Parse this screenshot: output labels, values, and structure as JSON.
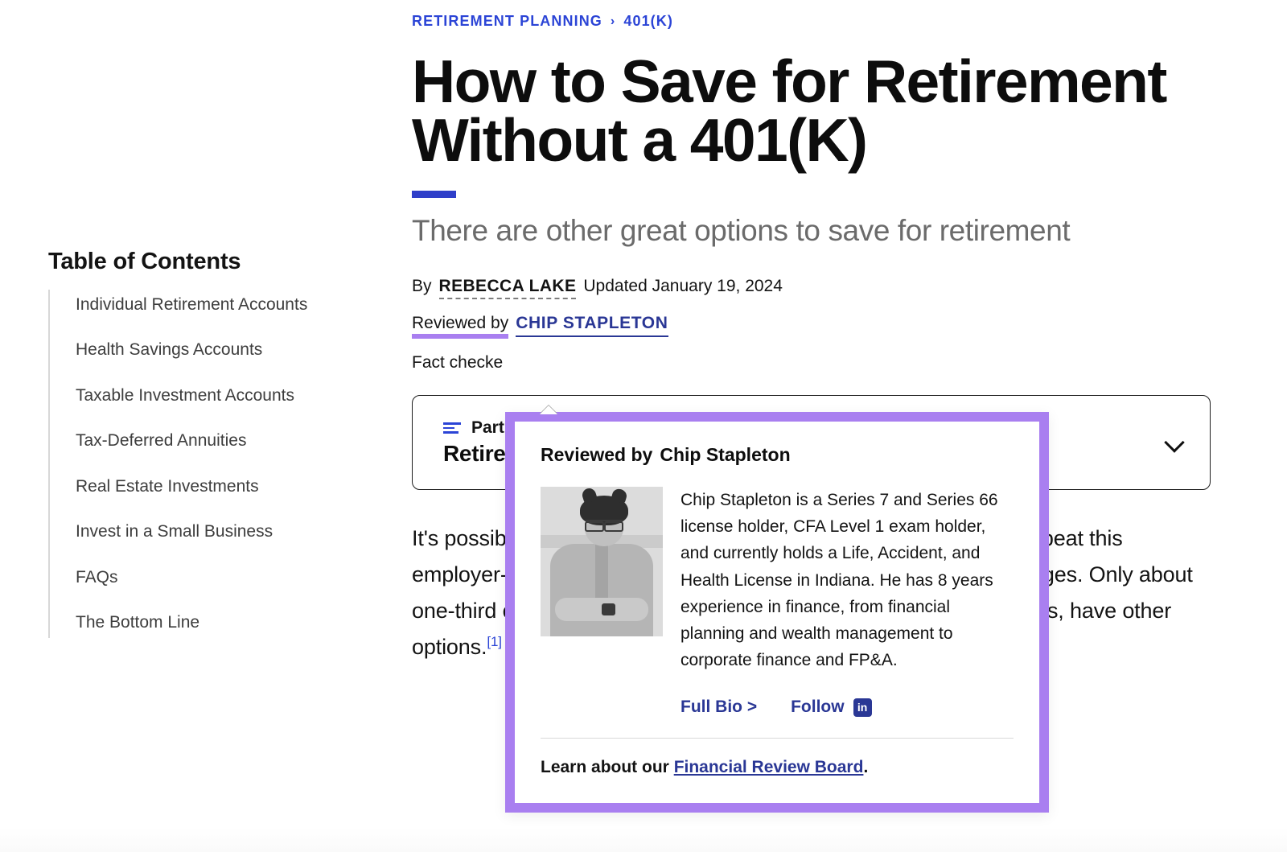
{
  "breadcrumb": {
    "parent": "RETIREMENT PLANNING",
    "separator": "›",
    "current": "401(K)"
  },
  "article": {
    "headline": "How to Save for Retirement Without a 401(K)",
    "dek": "There are other great options to save for retirement",
    "byline_prefix": "By",
    "author": "REBECCA LAKE",
    "updated": "Updated January 19, 2024",
    "reviewed_label": "Reviewed by",
    "reviewer": "CHIP STAPLETON",
    "factchecked_label": "Fact checke",
    "body_paragraph": "It's possible to save for retirement without a 401(k), but it's hard to beat this employer-sponsored plan for its contribution limits and tax advantages. Only about one-third of U.S. private industry workers, and many employer plans, have other options. [1]",
    "citation": "[1]"
  },
  "part_box": {
    "icon": "list-lines-icon",
    "eyebrow": "Part",
    "title": "Retire",
    "chevron": "chevron-down-icon"
  },
  "toc": {
    "title": "Table of Contents",
    "items": [
      "Individual Retirement Accounts",
      "Health Savings Accounts",
      "Taxable Investment Accounts",
      "Tax-Deferred Annuities",
      "Real Estate Investments",
      "Invest in a Small Business",
      "FAQs",
      "The Bottom Line"
    ]
  },
  "tooltip": {
    "head_prefix": "Reviewed by",
    "head_name": "Chip Stapleton",
    "photo_alt": "chip-stapleton-headshot",
    "bio": "Chip Stapleton is a Series 7 and Series 66 license holder, CFA Level 1 exam holder, and currently holds a Life, Accident, and Health License in Indiana. He has 8 years experience in finance, from financial planning and wealth management to corporate finance and FP&A.",
    "full_bio_link": "Full Bio >",
    "follow_link": "Follow",
    "linkedin_glyph": "in",
    "footer_prefix": "Learn about our",
    "footer_link": "Financial Review Board",
    "footer_period": "."
  },
  "colors": {
    "breadcrumb_blue": "#2b44d6",
    "accent_bar_blue": "#2f3fc9",
    "link_navy": "#2a3795",
    "tooltip_purple": "#a97ff0",
    "highlight_purple": "#a97ff0",
    "text_dark": "#131313",
    "dek_gray": "#6b6b6b"
  }
}
